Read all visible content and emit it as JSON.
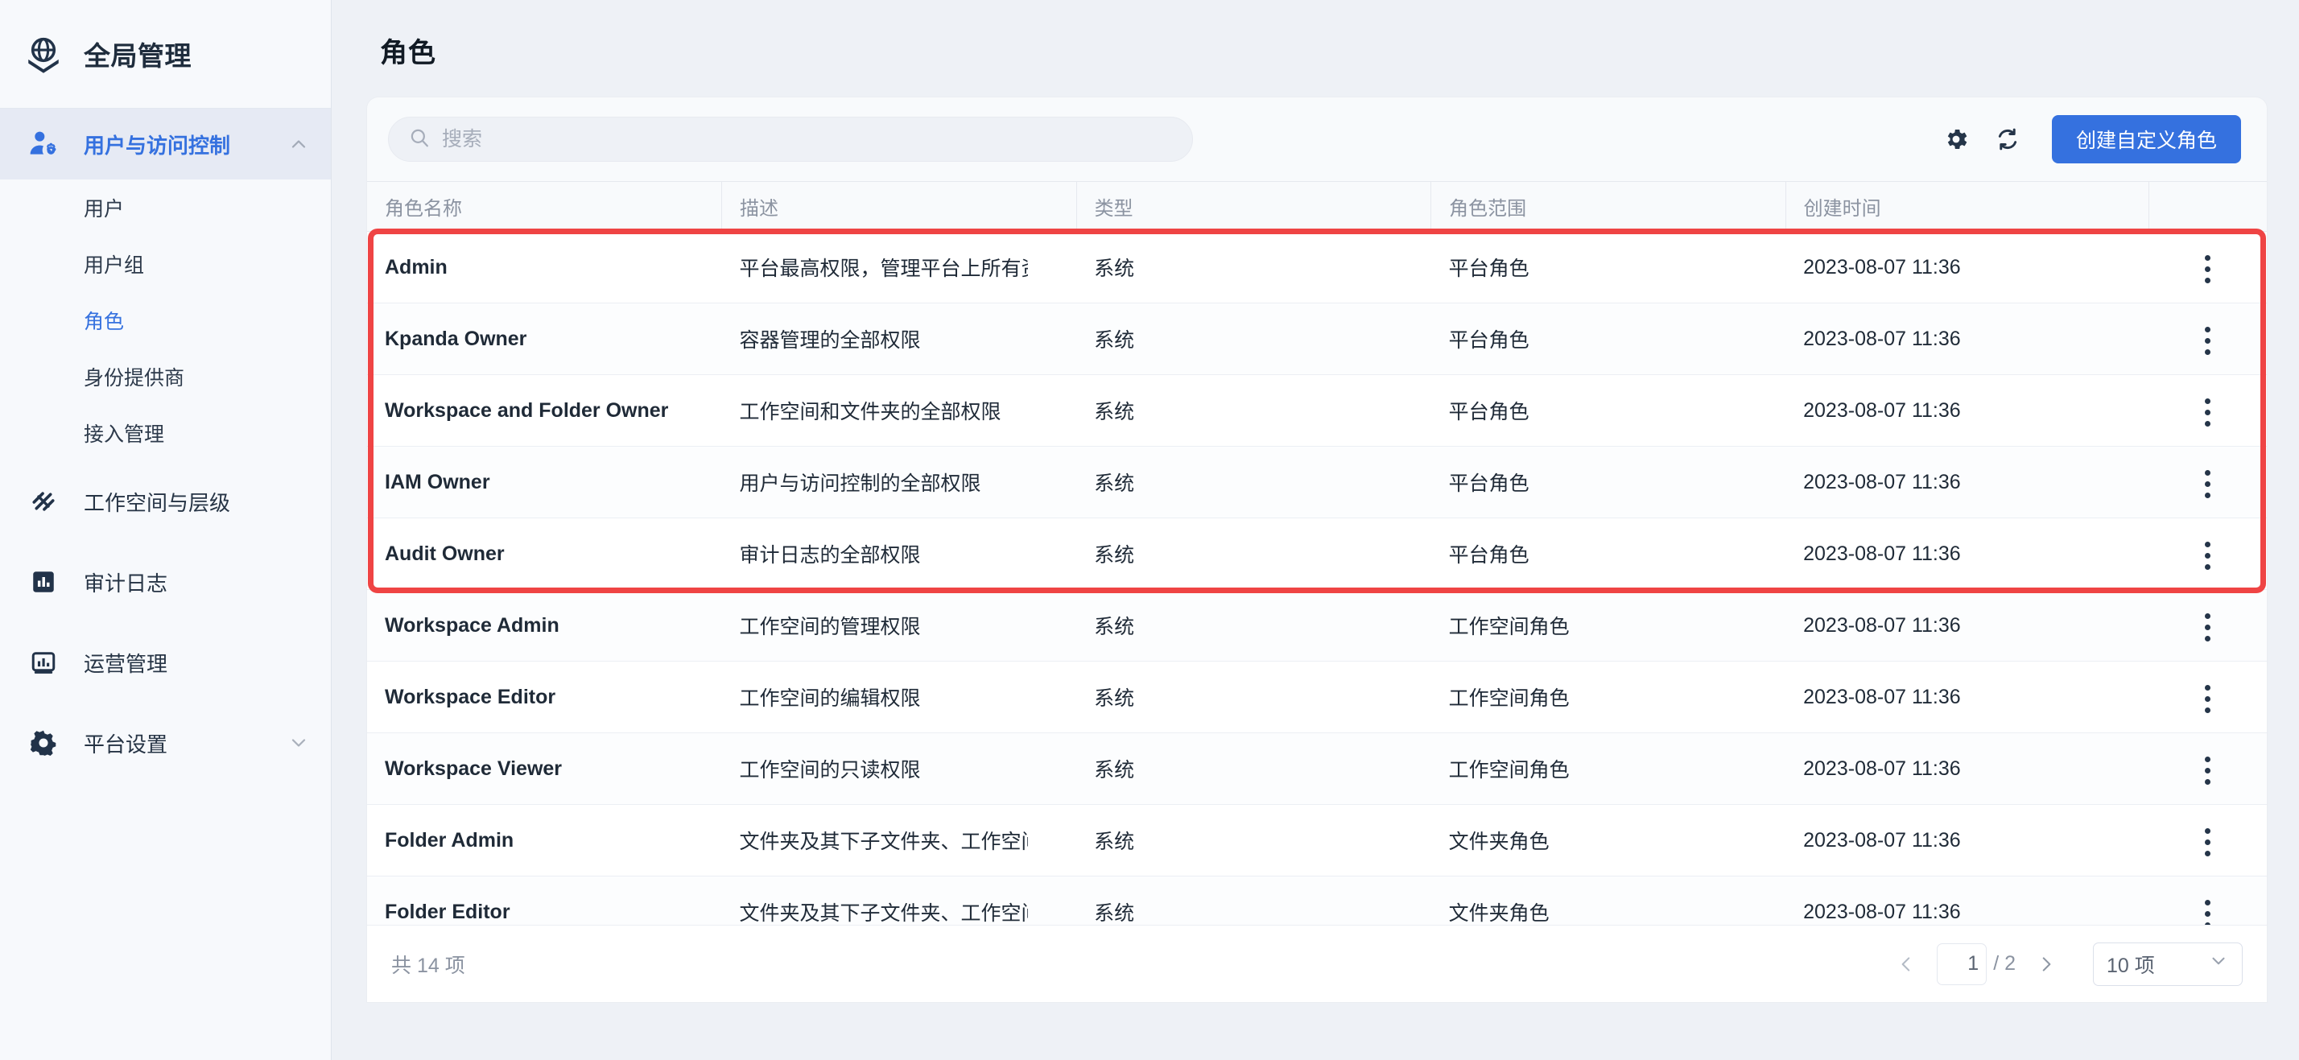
{
  "sidebar": {
    "brand": {
      "label": "全局管理",
      "icon": "globe-icon"
    },
    "group": {
      "label": "用户与访问控制",
      "icon": "user-gear-icon",
      "chevron": "chevron-up-icon",
      "items": [
        {
          "label": "用户"
        },
        {
          "label": "用户组"
        },
        {
          "label": "角色"
        },
        {
          "label": "身份提供商"
        },
        {
          "label": "接入管理"
        }
      ]
    },
    "items": [
      {
        "label": "工作空间与层级",
        "icon": "layers-icon"
      },
      {
        "label": "审计日志",
        "icon": "audit-chart-icon"
      },
      {
        "label": "运营管理",
        "icon": "ops-chart-icon"
      },
      {
        "label": "平台设置",
        "icon": "gear-icon",
        "chevron": "chevron-down-icon"
      }
    ]
  },
  "header": {
    "title": "角色"
  },
  "toolbar": {
    "search_placeholder": "搜索",
    "search_value": "",
    "search_icon": "search-icon",
    "settings_icon": "gear-icon",
    "refresh_icon": "refresh-icon",
    "create_label": "创建自定义角色"
  },
  "table": {
    "columns": [
      "角色名称",
      "描述",
      "类型",
      "角色范围",
      "创建时间",
      ""
    ],
    "rows": [
      {
        "name": "Admin",
        "desc": "平台最高权限，管理平台上所有资源",
        "type": "系统",
        "scope": "平台角色",
        "created": "2023-08-07 11:36"
      },
      {
        "name": "Kpanda Owner",
        "desc": "容器管理的全部权限",
        "type": "系统",
        "scope": "平台角色",
        "created": "2023-08-07 11:36"
      },
      {
        "name": "Workspace and Folder Owner",
        "desc": "工作空间和文件夹的全部权限",
        "type": "系统",
        "scope": "平台角色",
        "created": "2023-08-07 11:36"
      },
      {
        "name": "IAM Owner",
        "desc": "用户与访问控制的全部权限",
        "type": "系统",
        "scope": "平台角色",
        "created": "2023-08-07 11:36"
      },
      {
        "name": "Audit Owner",
        "desc": "审计日志的全部权限",
        "type": "系统",
        "scope": "平台角色",
        "created": "2023-08-07 11:36"
      },
      {
        "name": "Workspace Admin",
        "desc": "工作空间的管理权限",
        "type": "系统",
        "scope": "工作空间角色",
        "created": "2023-08-07 11:36"
      },
      {
        "name": "Workspace Editor",
        "desc": "工作空间的编辑权限",
        "type": "系统",
        "scope": "工作空间角色",
        "created": "2023-08-07 11:36"
      },
      {
        "name": "Workspace Viewer",
        "desc": "工作空间的只读权限",
        "type": "系统",
        "scope": "工作空间角色",
        "created": "2023-08-07 11:36"
      },
      {
        "name": "Folder Admin",
        "desc": "文件夹及其下子文件夹、工作空间的管理权限",
        "type": "系统",
        "scope": "文件夹角色",
        "created": "2023-08-07 11:36"
      },
      {
        "name": "Folder Editor",
        "desc": "文件夹及其下子文件夹、工作空间的编辑权限",
        "type": "系统",
        "scope": "文件夹角色",
        "created": "2023-08-07 11:36"
      }
    ],
    "row_menu_icon": "kebab-menu-icon"
  },
  "footer": {
    "total_label": "共 14 项",
    "prev_icon": "chevron-left-icon",
    "next_icon": "chevron-right-icon",
    "page_value": "1",
    "page_total": "/ 2",
    "page_size_label": "10 项",
    "page_size_chevron": "chevron-down-icon"
  },
  "annotation": {
    "highlight_color": "#ef4444",
    "highlight_rows": [
      "Admin",
      "Kpanda Owner",
      "Workspace and Folder Owner",
      "IAM Owner",
      "Audit Owner"
    ]
  },
  "colors": {
    "accent": "#3571df",
    "sidebar_bg": "#f7f9fc",
    "page_bg": "#eef1f6",
    "danger": "#ef4444"
  }
}
